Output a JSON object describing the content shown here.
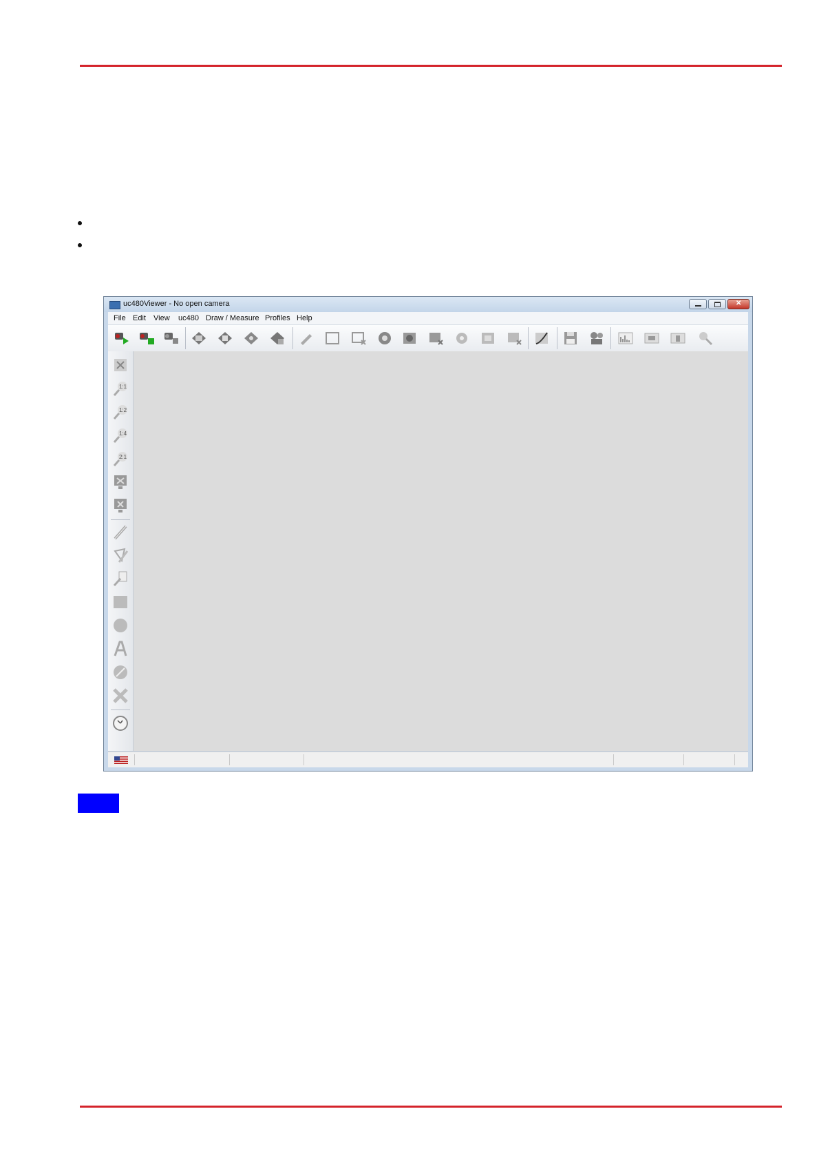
{
  "window": {
    "title": "uc480Viewer - No open camera"
  },
  "menu": [
    "File",
    "Edit",
    "View",
    "uc480",
    "Draw / Measure",
    "Profiles",
    "Help"
  ],
  "colors": {
    "rule": "#d4232b",
    "note_block": "#0000ff",
    "canvas": "#dcdcdc"
  },
  "toolbar_icons": [
    "open-camera-icon",
    "open-camera-live-icon",
    "close-camera-icon",
    "live-video-icon",
    "freeze-video-icon",
    "snapshot-video-icon",
    "stop-video-icon",
    "properties-icon",
    "aoi-icon",
    "aoi-remove-icon",
    "auto-settings-icon",
    "hotpixel-icon",
    "hotpixel-remove-icon",
    "auto-exposure-icon",
    "roi-icon",
    "roi-remove-icon",
    "curve-icon",
    "save-icon",
    "record-video-icon",
    "histogram-icon",
    "line-view-icon",
    "column-view-icon",
    "zoom-icon"
  ],
  "sidebar_icons": [
    "fit-window-icon",
    "zoom-1-1-icon",
    "zoom-1-2-icon",
    "zoom-1-4-icon",
    "zoom-2-1-icon",
    "fullscreen-icon",
    "monitor-icon",
    "draw-line-icon",
    "draw-polygon-icon",
    "measure-icon",
    "draw-rectangle-icon",
    "draw-ellipse-icon",
    "draw-text-icon",
    "color-icon",
    "delete-drawing-icon",
    "clock-icon"
  ],
  "sidebar_labels": {
    "zoom_1_1": "1:1",
    "zoom_1_2": "1:2",
    "zoom_1_4": "1:4",
    "zoom_2_1": "2:1"
  }
}
